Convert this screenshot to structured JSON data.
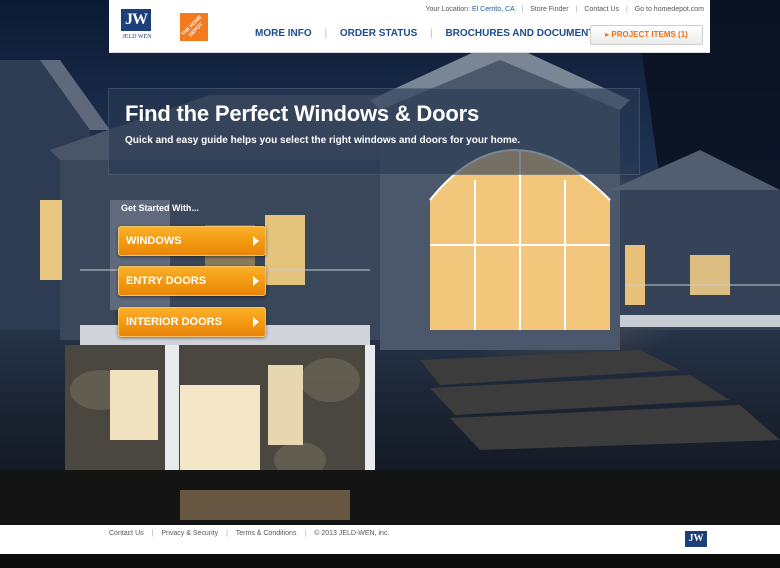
{
  "header": {
    "jw_logo_text": "JW",
    "jw_logo_sub": "JELD WEN",
    "homedepot_logo_text": "THE HOME DEPOT",
    "utility": {
      "location_label": "Your Location:",
      "location_value": "El Cerrito, CA",
      "store_finder": "Store Finder",
      "contact_us": "Contact Us",
      "go_to": "Go to homedepot.com"
    },
    "nav": {
      "more_info": "MORE INFO",
      "order_status": "ORDER STATUS",
      "brochures": "BROCHURES AND DOCUMENTS"
    },
    "project_items": "▸ PROJECT ITEMS  (1)"
  },
  "hero": {
    "title": "Find the Perfect Windows & Doors",
    "subtitle": "Quick and easy guide helps you select the right windows and doors for your home."
  },
  "get_started": {
    "label": "Get Started With...",
    "buttons": {
      "windows": "WINDOWS",
      "entry_doors": "ENTRY DOORS",
      "interior_doors": "INTERIOR DOORS"
    }
  },
  "footer": {
    "contact_us": "Contact Us",
    "privacy": "Privacy & Security",
    "terms": "Terms & Conditions",
    "copyright": "© 2013 JELD-WEN, inc.",
    "logo_text": "JW"
  },
  "colors": {
    "brand_blue": "#1c4b8f",
    "cta_orange": "#f39a11",
    "homedepot_orange": "#f47a20"
  }
}
